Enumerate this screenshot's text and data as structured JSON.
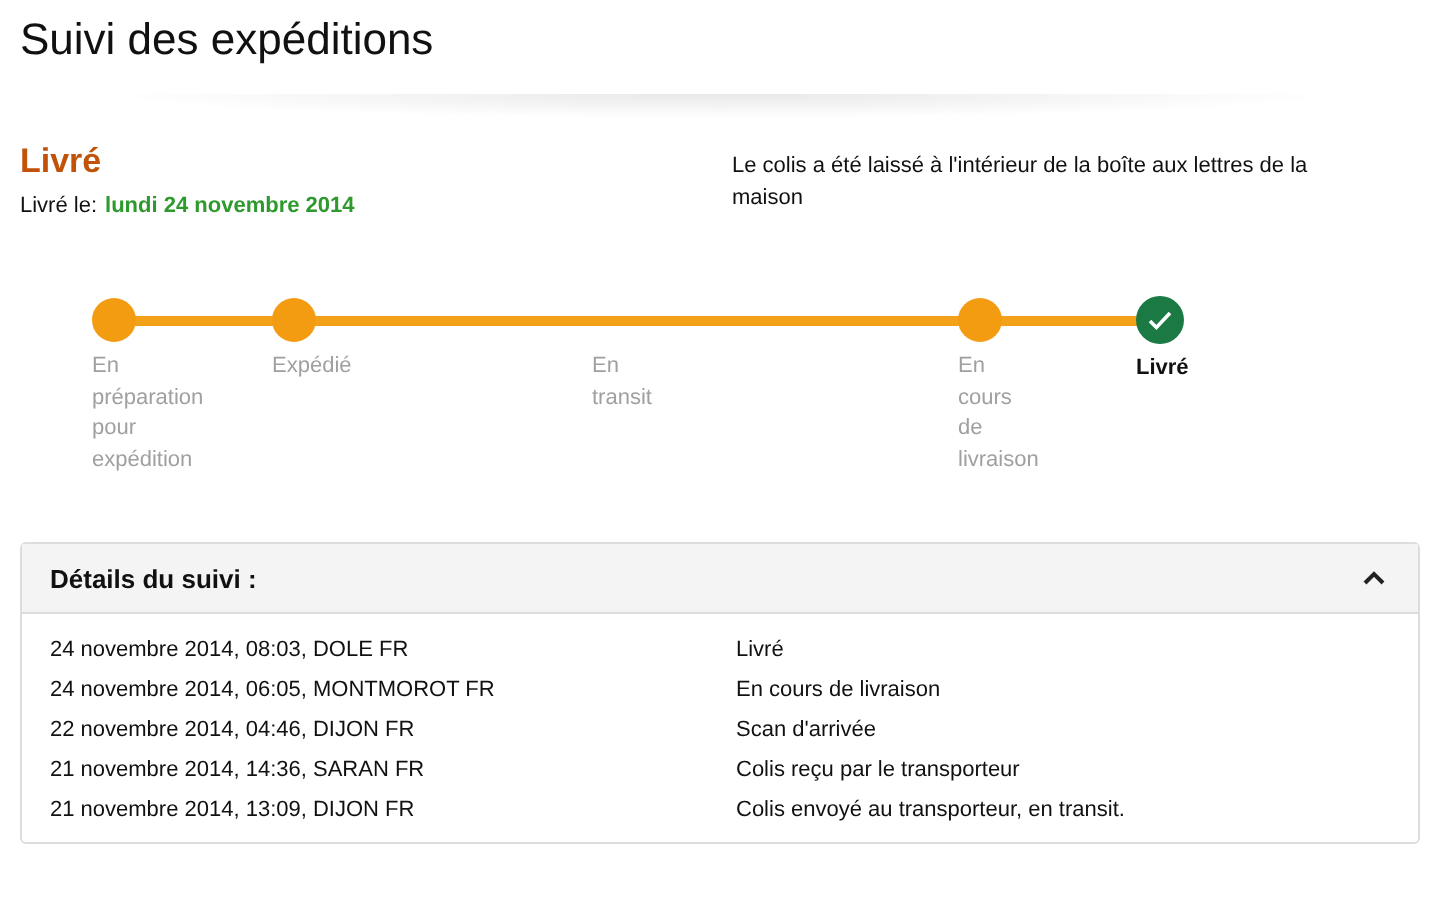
{
  "page_title": "Suivi des expéditions",
  "status": {
    "title": "Livré",
    "date_label": "Livré le:",
    "date": "lundi 24 novembre 2014",
    "note": "Le colis a été laissé à l'intérieur de la boîte aux lettres de la maison"
  },
  "progress": {
    "steps": [
      {
        "label": "En préparation pour expédition",
        "kind": "done"
      },
      {
        "label": "Expédié",
        "kind": "done"
      },
      {
        "label": "En transit",
        "kind": "passage"
      },
      {
        "label": "En cours de livraison",
        "kind": "done"
      },
      {
        "label": "Livré",
        "kind": "current"
      }
    ]
  },
  "details": {
    "title": "Détails du suivi :",
    "expanded": true,
    "rows": [
      {
        "when": "24 novembre 2014, 08:03, DOLE FR",
        "event": "Livré"
      },
      {
        "when": "24 novembre 2014, 06:05, MONTMOROT FR",
        "event": "En cours de livraison"
      },
      {
        "when": "22 novembre 2014, 04:46, DIJON FR",
        "event": "Scan d'arrivée"
      },
      {
        "when": "21 novembre 2014, 14:36, SARAN FR",
        "event": "Colis reçu par le transporteur"
      },
      {
        "when": "21 novembre 2014, 13:09, DIJON FR",
        "event": "Colis envoyé au transporteur, en transit."
      }
    ]
  }
}
